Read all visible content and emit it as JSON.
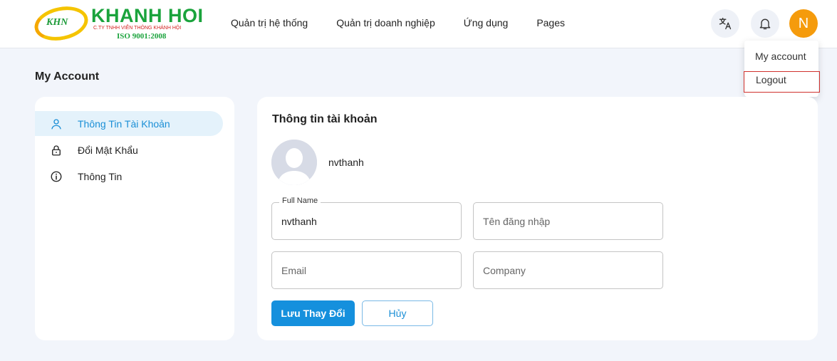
{
  "logo": {
    "mark": "KHN",
    "brand": "KHANH HOI",
    "subtitle": "C.TY TNHH VIỄN THÔNG KHÁNH HỘI",
    "iso": "ISO 9001:2008"
  },
  "nav": {
    "items": [
      "Quản trị hệ thống",
      "Quản trị doanh nghiệp",
      "Ứng dụng",
      "Pages"
    ]
  },
  "header": {
    "avatar_initial": "N",
    "translate_icon": "translate-icon",
    "bell_icon": "bell-icon"
  },
  "dropdown": {
    "my_account": "My account",
    "logout": "Logout"
  },
  "page": {
    "title": "My Account"
  },
  "sidebar": {
    "items": [
      {
        "label": "Thông Tin Tài Khoản",
        "icon": "user-icon",
        "active": true
      },
      {
        "label": "Đổi Mật Khẩu",
        "icon": "lock-icon",
        "active": false
      },
      {
        "label": "Thông Tin",
        "icon": "info-icon",
        "active": false
      }
    ]
  },
  "account": {
    "title": "Thông tin tài khoản",
    "username": "nvthanh",
    "fields": {
      "full_name": {
        "label": "Full Name",
        "value": "nvthanh"
      },
      "login_name": {
        "placeholder": "Tên đăng nhập"
      },
      "email": {
        "placeholder": "Email"
      },
      "company": {
        "placeholder": "Company"
      }
    },
    "save_label": "Lưu Thay Đổi",
    "cancel_label": "Hủy"
  },
  "colors": {
    "primary": "#1590dd",
    "avatar": "#f59b0c",
    "logo_green": "#1aa33c",
    "logout_border": "#d0312d"
  }
}
